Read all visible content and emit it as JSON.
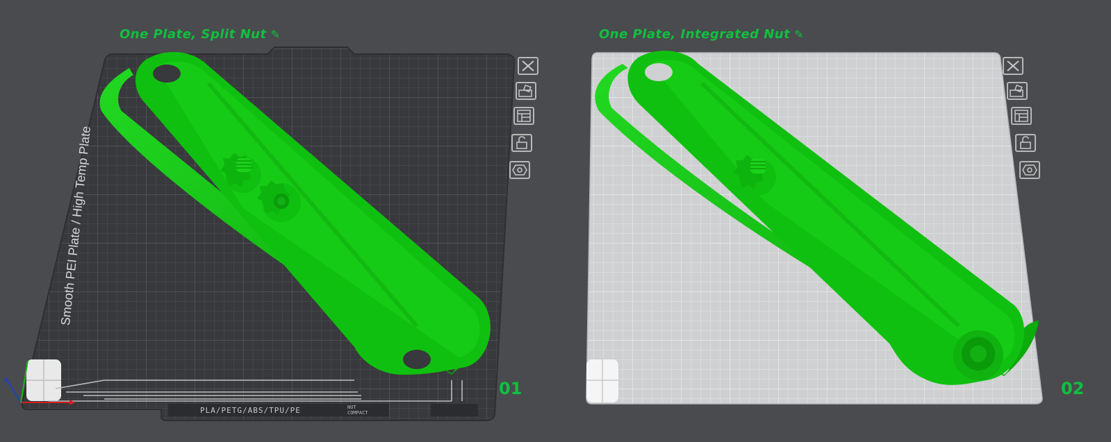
{
  "plates": [
    {
      "title": "One Plate, Split Nut",
      "number": "01",
      "bed_label": "Smooth PEI Plate / High Temp Plate",
      "filament_label": "PLA/PETG/ABS/TPU/PE",
      "nut_label_1": "NUT",
      "nut_label_2": "COMPACT"
    },
    {
      "title": "One Plate, Integrated Nut",
      "number": "02"
    }
  ],
  "toolbar_icons": [
    "close-icon",
    "auto-arrange-icon",
    "layout-icon",
    "lock-icon",
    "settings-hex-icon"
  ],
  "colors": {
    "background": "#4a4b4e",
    "model": "#10c010",
    "accent": "#10c040",
    "bed_dark": "#38393c",
    "bed_light": "#cfd0d2"
  }
}
